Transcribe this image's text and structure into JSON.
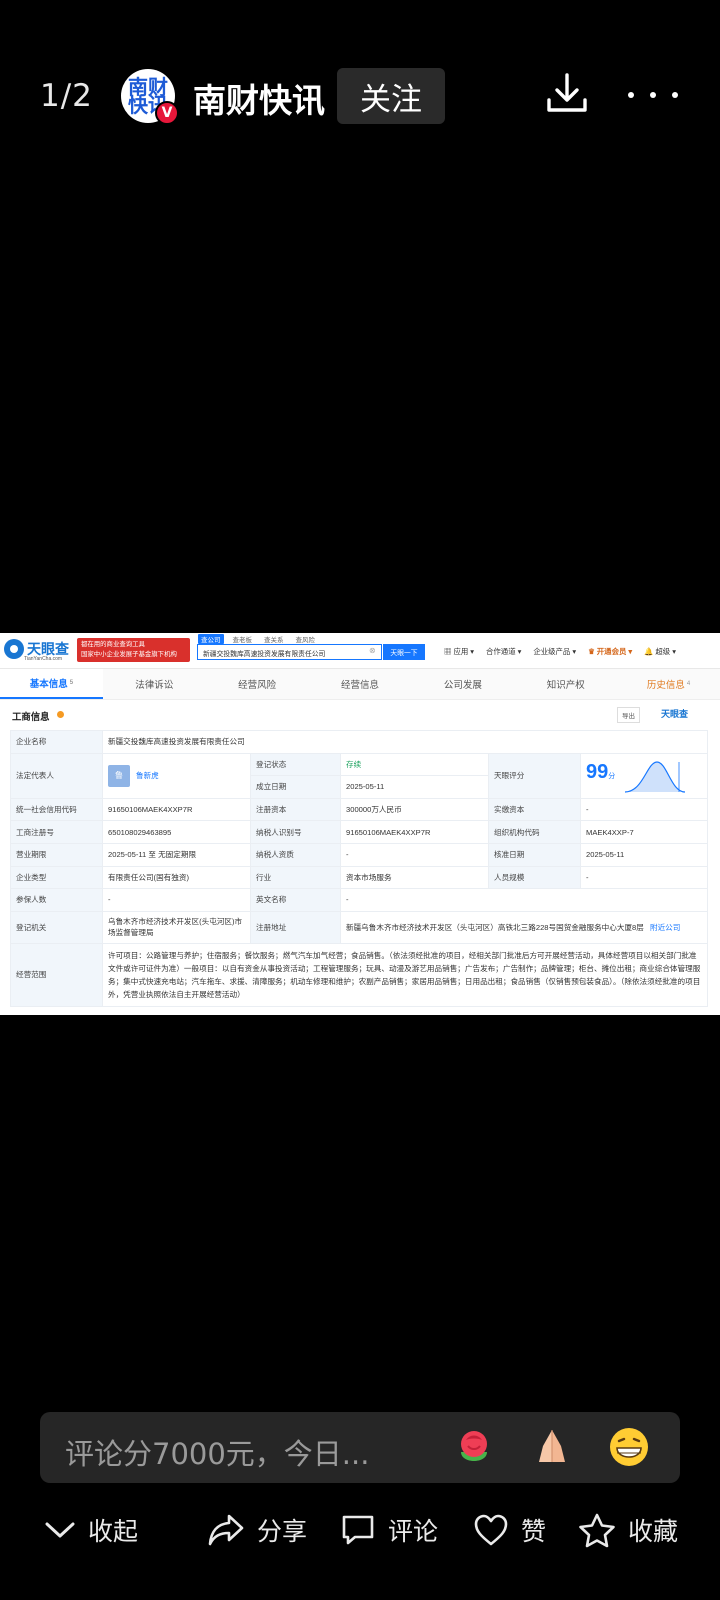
{
  "topbar": {
    "page_counter": "1/2",
    "avatar_text": "南财快讯",
    "verified_badge": "V",
    "author_name": "南财快讯",
    "follow_label": "关注",
    "icons": [
      "download-icon",
      "more-icon"
    ]
  },
  "image": {
    "header": {
      "logo_text": "天眼查",
      "logo_sub": "TianYanCha.com",
      "ad_line1": "都在用的商业查询工具",
      "ad_line2": "国家中小企业发展子基金旗下机构",
      "search_tabs": [
        "查公司",
        "查老板",
        "查关系",
        "查风险"
      ],
      "search_value": "新疆交投魏库高速投资发展有限责任公司",
      "search_button": "天眼一下",
      "nav": [
        "应用",
        "合作通道",
        "企业级产品",
        "开通会员",
        "超级"
      ]
    },
    "tabs": [
      {
        "label": "基本信息",
        "count": "5"
      },
      {
        "label": "法律诉讼",
        "count": ""
      },
      {
        "label": "经营风险",
        "count": ""
      },
      {
        "label": "经营信息",
        "count": ""
      },
      {
        "label": "公司发展",
        "count": ""
      },
      {
        "label": "知识产权",
        "count": ""
      },
      {
        "label": "历史信息",
        "count": "4"
      }
    ],
    "section_title": "工商信息",
    "export_label": "导出",
    "brand_mark": "天眼查",
    "rows": {
      "company_name_label": "企业名称",
      "company_name": "新疆交投魏库高速投资发展有限责任公司",
      "legal_rep_label": "法定代表人",
      "legal_rep_avatar": "鲁",
      "legal_rep": "鲁新虎",
      "reg_status_label": "登记状态",
      "reg_status": "存续",
      "found_date_label": "成立日期",
      "found_date": "2025-05-11",
      "score_label": "天眼评分",
      "score": "99",
      "score_unit": "分",
      "credit_code_label": "统一社会信用代码",
      "credit_code": "91650106MAEK4XXP7R",
      "reg_capital_label": "注册资本",
      "reg_capital": "300000万人民币",
      "paid_capital_label": "实缴资本",
      "paid_capital": "-",
      "reg_no_label": "工商注册号",
      "reg_no": "650108029463895",
      "taxpayer_id_label": "纳税人识别号",
      "taxpayer_id": "91650106MAEK4XXP7R",
      "org_code_label": "组织机构代码",
      "org_code": "MAEK4XXP-7",
      "term_label": "营业期限",
      "term": "2025-05-11 至 无固定期限",
      "taxpayer_qual_label": "纳税人资质",
      "taxpayer_qual": "-",
      "approve_date_label": "核准日期",
      "approve_date": "2025-05-11",
      "type_label": "企业类型",
      "type": "有限责任公司(国有独资)",
      "industry_label": "行业",
      "industry": "资本市场服务",
      "staff_label": "人员规模",
      "staff": "-",
      "insured_label": "参保人数",
      "insured": "-",
      "en_name_label": "英文名称",
      "en_name": "-",
      "authority_label": "登记机关",
      "authority": "乌鲁木齐市经济技术开发区(头屯河区)市场监督管理局",
      "address_label": "注册地址",
      "address": "新疆乌鲁木齐市经济技术开发区（头屯河区）高铁北三路228号国贸金融服务中心大厦8层",
      "nearby_link": "附近公司",
      "scope_label": "经营范围",
      "scope": "许可项目：公路管理与养护；住宿服务；餐饮服务；燃气汽车加气经营；食品销售。（依法须经批准的项目，经相关部门批准后方可开展经营活动，具体经营项目以相关部门批准文件或许可证件为准）一般项目：以自有资金从事投资活动；工程管理服务；玩具、动漫及游艺用品销售；广告发布；广告制作；品牌管理；柜台、摊位出租；商业综合体管理服务；集中式快速充电站；汽车拖车、求援、清障服务；机动车修理和维护；农副产品销售；家居用品销售；日用品出租；食品销售（仅销售预包装食品）。（除依法须经批准的项目外，凭营业执照依法自主开展经营活动）"
    }
  },
  "comment": {
    "placeholder": "评论分7000元，今日...",
    "emojis": [
      "rose-emoji",
      "pray-emoji",
      "grin-emoji"
    ]
  },
  "actions": {
    "collapse": "收起",
    "share": "分享",
    "comment": "评论",
    "like": "赞",
    "favorite": "收藏"
  }
}
